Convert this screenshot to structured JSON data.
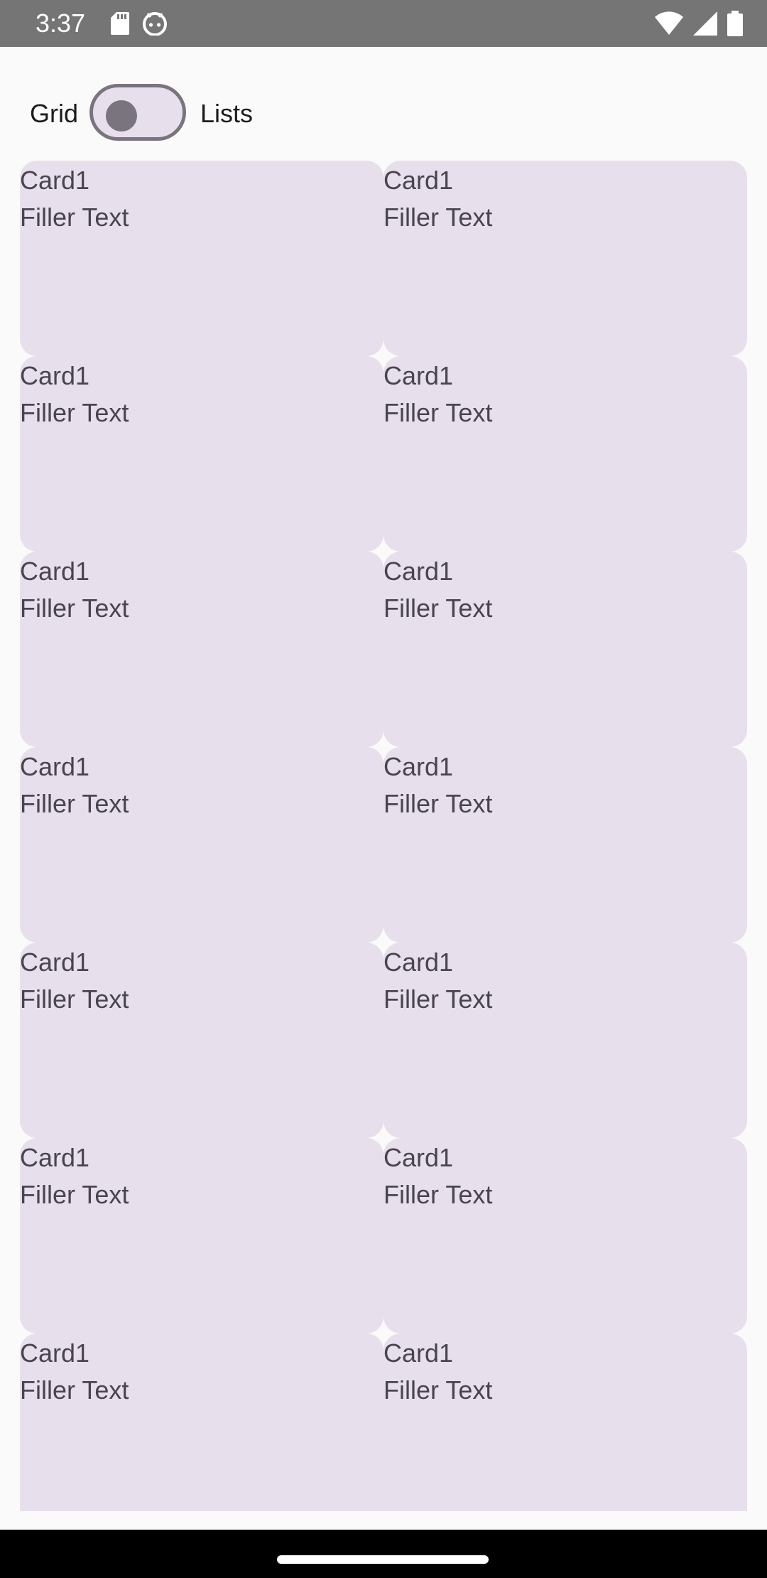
{
  "status_bar": {
    "time": "3:37",
    "left_icons": [
      "sd-card-icon",
      "android-debug-icon"
    ],
    "right_icons": [
      "wifi-icon",
      "cellular-signal-icon",
      "battery-icon"
    ],
    "background_color": "#757575"
  },
  "toolbar": {
    "grid_label": "Grid",
    "lists_label": "Lists",
    "switch_on": false
  },
  "cards": [
    {
      "title": "Card1",
      "body": "Filler Text"
    },
    {
      "title": "Card1",
      "body": "Filler Text"
    },
    {
      "title": "Card1",
      "body": "Filler Text"
    },
    {
      "title": "Card1",
      "body": "Filler Text"
    },
    {
      "title": "Card1",
      "body": "Filler Text"
    },
    {
      "title": "Card1",
      "body": "Filler Text"
    },
    {
      "title": "Card1",
      "body": "Filler Text"
    },
    {
      "title": "Card1",
      "body": "Filler Text"
    },
    {
      "title": "Card1",
      "body": "Filler Text"
    },
    {
      "title": "Card1",
      "body": "Filler Text"
    },
    {
      "title": "Card1",
      "body": "Filler Text"
    },
    {
      "title": "Card1",
      "body": "Filler Text"
    },
    {
      "title": "Card1",
      "body": "Filler Text"
    },
    {
      "title": "Card1",
      "body": "Filler Text"
    }
  ],
  "colors": {
    "card_background": "#e7e0ec",
    "card_text": "#49454f",
    "switch_outline": "#79747e",
    "page_background": "#fafafa"
  }
}
